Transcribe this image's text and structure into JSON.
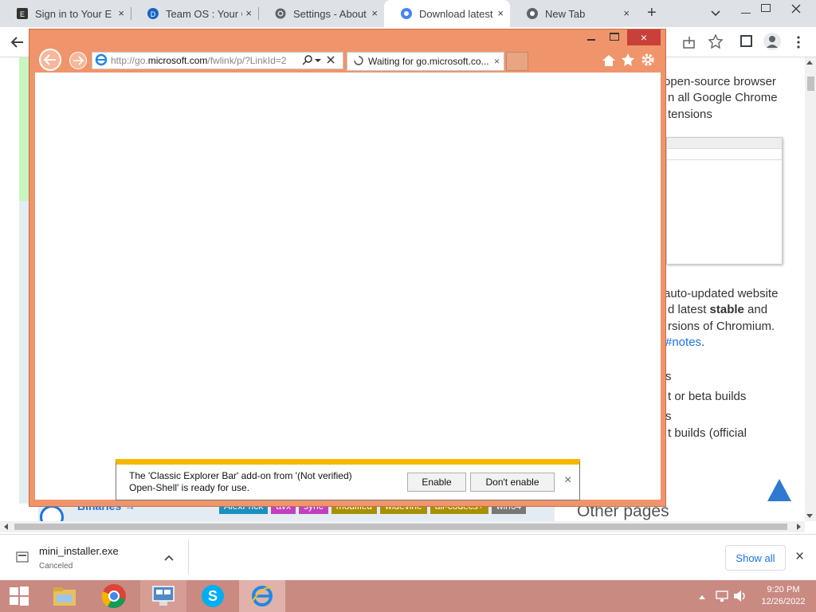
{
  "chrome": {
    "tabs": [
      {
        "title": "Sign in to Your Ep",
        "icon": "epic-icon"
      },
      {
        "title": "Team OS : Your O",
        "icon": "teamos-icon"
      },
      {
        "title": "Settings - About",
        "icon": "gear-icon"
      },
      {
        "title": "Download latest",
        "icon": "chromium-icon"
      },
      {
        "title": "New Tab",
        "icon": "chrome-icon"
      }
    ],
    "new_tab_label": "+",
    "close_label": "×"
  },
  "bgpage": {
    "lines": [
      "open-source browser",
      "n all Google Chrome",
      "tensions",
      "auto-updated website",
      "d latest ",
      "rsions of Chromium.",
      "#notes",
      "s",
      "t or beta builds",
      "s",
      "t builds (official"
    ],
    "stable_word": "stable",
    "and_word": " and",
    "period": ".",
    "binaries_label": "Binaries →",
    "other_pages": "Other pages",
    "tags": [
      "AlexFrick",
      "avx",
      "sync",
      "modified",
      "widevine",
      "all-codecs+",
      "win64"
    ]
  },
  "ie": {
    "url_prefix": "http://go.",
    "url_domain": "microsoft.com",
    "url_suffix": "/fwlink/p/?LinkId=2",
    "tab_title": "Waiting for go.microsoft.co...",
    "close_label": "×"
  },
  "notification": {
    "message_line1": "The 'Classic Explorer Bar' add-on from '(Not verified)",
    "message_line2": "Open-Shell' is ready for use.",
    "enable_label": "Enable",
    "dont_enable_label": "Don't enable",
    "close_label": "×"
  },
  "downloads": {
    "filename": "mini_installer.exe",
    "status": "Canceled",
    "show_all_label": "Show all",
    "close_label": "×"
  },
  "taskbar": {
    "time": "9:20 PM",
    "date": "12/26/2022"
  },
  "colors": {
    "ie_frame": "#f0956b",
    "taskbar": "#c98a82",
    "notify_accent": "#f5b800",
    "link": "#1a73e8"
  }
}
